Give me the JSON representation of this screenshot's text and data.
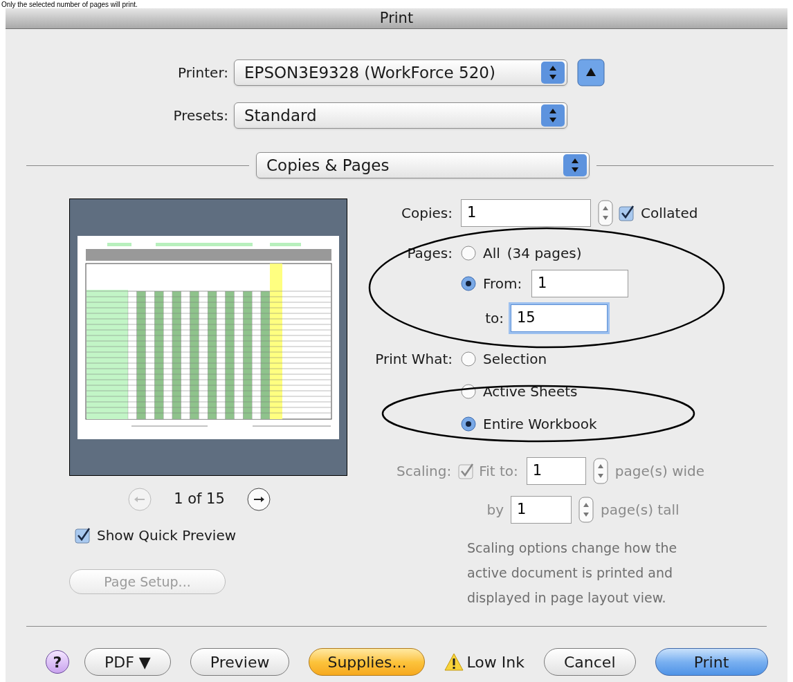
{
  "caption": "Only the selected number of pages will print.",
  "window": {
    "title": "Print"
  },
  "printer": {
    "label": "Printer:",
    "value": "EPSON3E9328 (WorkForce 520)"
  },
  "presets": {
    "label": "Presets:",
    "value": "Standard"
  },
  "section": {
    "value": "Copies & Pages"
  },
  "preview": {
    "page": "1 of 15",
    "quick_preview": {
      "label": "Show Quick Preview",
      "checked": true
    }
  },
  "page_setup": {
    "label": "Page Setup...",
    "disabled": true
  },
  "copies": {
    "label": "Copies:",
    "value": "1",
    "collated": {
      "label": "Collated",
      "checked": true
    }
  },
  "pages": {
    "label": "Pages:",
    "all": {
      "label": "All",
      "note": "(34 pages)",
      "selected": false
    },
    "from": {
      "label": "From:",
      "value": "1",
      "selected": true
    },
    "to": {
      "label": "to:",
      "value": "15",
      "focused": true
    }
  },
  "print_what": {
    "label": "Print What:",
    "options": [
      {
        "label": "Selection",
        "selected": false
      },
      {
        "label": "Active Sheets",
        "selected": false
      },
      {
        "label": "Entire Workbook",
        "selected": true
      }
    ]
  },
  "scaling": {
    "label": "Scaling:",
    "disabled": true,
    "fit": {
      "label": "Fit to:",
      "checked": true
    },
    "wide": {
      "value": "1",
      "unit": "page(s) wide"
    },
    "tall": {
      "label": "by",
      "value": "1",
      "unit": "page(s) tall"
    },
    "note": "Scaling options change how the active document is printed and displayed in page layout view."
  },
  "help": "?",
  "buttons": [
    {
      "label": "PDF ▼",
      "kind": "normal"
    },
    {
      "label": "Preview",
      "kind": "normal"
    },
    {
      "label": "Supplies...",
      "kind": "supplies"
    },
    {
      "label": "Low Ink",
      "kind": "warning"
    },
    {
      "label": "Cancel",
      "kind": "normal"
    },
    {
      "label": "Print",
      "kind": "default"
    }
  ]
}
